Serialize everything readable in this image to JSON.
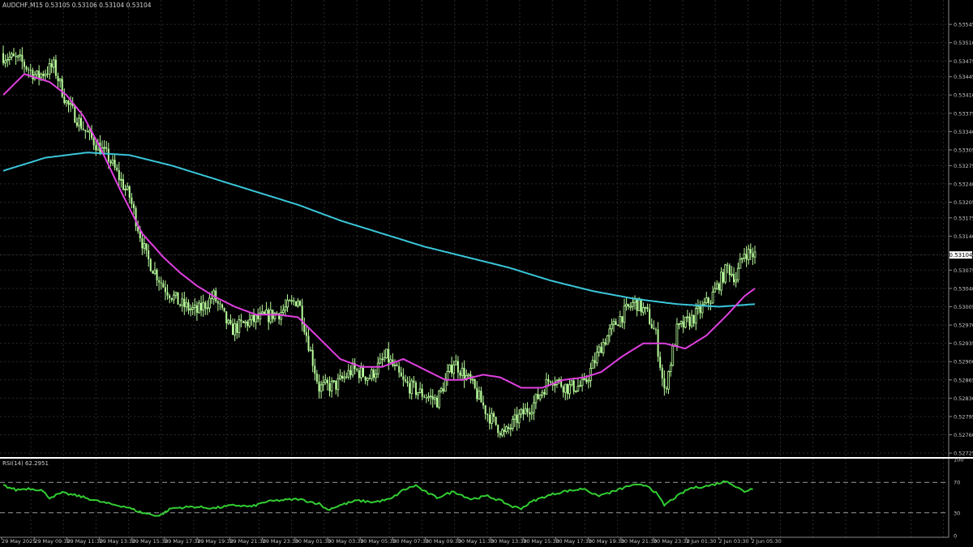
{
  "header": {
    "symbol_line": "AUDCHF,M15  0.53105 0.53106 0.53104 0.53104"
  },
  "colors": {
    "background": "#000000",
    "grid": "#2a2a2a",
    "candle": "#b9ff9c",
    "ma_fast": "#e040e0",
    "ma_slow": "#3ac6da",
    "rsi_line": "#32cd32",
    "axis_text": "#c8c8c8",
    "price_label_bg": "#ffffff",
    "price_label_text": "#000000"
  },
  "chart_data": [
    {
      "type": "candlestick",
      "title": "AUDCHF,M15",
      "ohlc_header": "0.53105 0.53106 0.53104 0.53104",
      "current_price": "0.53104",
      "grid": true,
      "ylim": [
        0.52719,
        0.5357
      ],
      "y_tick_labels": [
        "0.53545",
        "0.53510",
        "0.53475",
        "0.53445",
        "0.53410",
        "0.53375",
        "0.53340",
        "0.53305",
        "0.53275",
        "0.53240",
        "0.53205",
        "0.53175",
        "0.53140",
        "0.53104",
        "0.53075",
        "0.53040",
        "0.53005",
        "0.52970",
        "0.52935",
        "0.52900",
        "0.52865",
        "0.52830",
        "0.52795",
        "0.52760",
        "0.52725"
      ],
      "y_tick_values": [
        0.53545,
        0.5351,
        0.53475,
        0.53445,
        0.5341,
        0.53375,
        0.5334,
        0.53305,
        0.53275,
        0.5324,
        0.53205,
        0.53175,
        0.5314,
        0.53104,
        0.53075,
        0.5304,
        0.53005,
        0.5297,
        0.52935,
        0.529,
        0.52865,
        0.5283,
        0.52795,
        0.5276,
        0.52725
      ],
      "close_anchors": [
        [
          0,
          0.53485
        ],
        [
          8,
          0.53475
        ],
        [
          16,
          0.53445
        ],
        [
          24,
          0.53465
        ],
        [
          30,
          0.53395
        ],
        [
          40,
          0.53335
        ],
        [
          50,
          0.5329
        ],
        [
          60,
          0.53215
        ],
        [
          68,
          0.531
        ],
        [
          76,
          0.53045
        ],
        [
          84,
          0.5301
        ],
        [
          92,
          0.52995
        ],
        [
          100,
          0.53025
        ],
        [
          108,
          0.5296
        ],
        [
          116,
          0.52975
        ],
        [
          124,
          0.52985
        ],
        [
          132,
          0.52995
        ],
        [
          140,
          0.5302
        ],
        [
          150,
          0.5285
        ],
        [
          158,
          0.52855
        ],
        [
          166,
          0.52885
        ],
        [
          174,
          0.5287
        ],
        [
          182,
          0.5291
        ],
        [
          190,
          0.5286
        ],
        [
          198,
          0.5284
        ],
        [
          206,
          0.52825
        ],
        [
          214,
          0.529
        ],
        [
          222,
          0.5286
        ],
        [
          230,
          0.528
        ],
        [
          238,
          0.5276
        ],
        [
          244,
          0.5279
        ],
        [
          252,
          0.5282
        ],
        [
          260,
          0.5287
        ],
        [
          268,
          0.5285
        ],
        [
          276,
          0.52855
        ],
        [
          284,
          0.5293
        ],
        [
          292,
          0.5298
        ],
        [
          300,
          0.53015
        ],
        [
          306,
          0.5299
        ],
        [
          310,
          0.5295
        ],
        [
          314,
          0.5284
        ],
        [
          320,
          0.5296
        ],
        [
          328,
          0.52985
        ],
        [
          336,
          0.5302
        ],
        [
          344,
          0.5308
        ],
        [
          348,
          0.5306
        ],
        [
          352,
          0.5311
        ],
        [
          356,
          0.53105
        ],
        [
          357,
          0.53104
        ]
      ],
      "series": [
        {
          "type": "line",
          "anchors": [
            [
              0,
              0.5341
            ],
            [
              10,
              0.5345
            ],
            [
              22,
              0.53435
            ],
            [
              30,
              0.5341
            ],
            [
              38,
              0.5337
            ],
            [
              46,
              0.5331
            ],
            [
              56,
              0.53225
            ],
            [
              66,
              0.53145
            ],
            [
              76,
              0.531
            ],
            [
              84,
              0.5307
            ],
            [
              92,
              0.53045
            ],
            [
              100,
              0.53025
            ],
            [
              110,
              0.53005
            ],
            [
              120,
              0.5299
            ],
            [
              130,
              0.5299
            ],
            [
              140,
              0.52985
            ],
            [
              150,
              0.52945
            ],
            [
              160,
              0.52905
            ],
            [
              170,
              0.5289
            ],
            [
              180,
              0.5289
            ],
            [
              190,
              0.52905
            ],
            [
              200,
              0.52885
            ],
            [
              210,
              0.52865
            ],
            [
              218,
              0.52865
            ],
            [
              228,
              0.52875
            ],
            [
              236,
              0.5287
            ],
            [
              246,
              0.5285
            ],
            [
              256,
              0.5285
            ],
            [
              266,
              0.52865
            ],
            [
              276,
              0.5287
            ],
            [
              284,
              0.5288
            ],
            [
              294,
              0.5291
            ],
            [
              304,
              0.52935
            ],
            [
              314,
              0.52935
            ],
            [
              324,
              0.52925
            ],
            [
              334,
              0.5295
            ],
            [
              344,
              0.5299
            ],
            [
              352,
              0.53025
            ],
            [
              357,
              0.5304
            ]
          ]
        },
        {
          "type": "line",
          "anchors": [
            [
              0,
              0.53265
            ],
            [
              20,
              0.5329
            ],
            [
              40,
              0.533
            ],
            [
              60,
              0.53295
            ],
            [
              80,
              0.53275
            ],
            [
              100,
              0.5325
            ],
            [
              120,
              0.53225
            ],
            [
              140,
              0.532
            ],
            [
              160,
              0.5317
            ],
            [
              180,
              0.53145
            ],
            [
              200,
              0.5312
            ],
            [
              220,
              0.531
            ],
            [
              240,
              0.5308
            ],
            [
              260,
              0.53055
            ],
            [
              280,
              0.53035
            ],
            [
              300,
              0.5302
            ],
            [
              320,
              0.5301
            ],
            [
              340,
              0.53005
            ],
            [
              357,
              0.5301
            ]
          ]
        }
      ],
      "x_tick_labels": [
        "29 May 2025",
        "29 May 09:30",
        "29 May 11:30",
        "29 May 13:30",
        "29 May 15:30",
        "29 May 17:30",
        "29 May 19:30",
        "29 May 21:30",
        "29 May 23:30",
        "30 May 01:30",
        "30 May 03:30",
        "30 May 05:30",
        "30 May 07:30",
        "30 May 09:30",
        "30 May 11:30",
        "30 May 13:30",
        "30 May 15:30",
        "30 May 17:30",
        "30 May 19:30",
        "30 May 21:30",
        "30 May 23:30",
        "2 Jun 01:30",
        "2 Jun 03:30",
        "2 Jun 05:30"
      ]
    },
    {
      "type": "line",
      "title": "RSI(14) 62.2951",
      "ylim": [
        0,
        100
      ],
      "y_tick_labels": [
        "100",
        "70",
        "30",
        "0"
      ],
      "y_tick_values": [
        100,
        70,
        30,
        0
      ],
      "levels": [
        70,
        30
      ],
      "series": [
        {
          "anchors": [
            [
              0,
              66
            ],
            [
              6,
              60
            ],
            [
              12,
              62
            ],
            [
              18,
              60
            ],
            [
              22,
              50
            ],
            [
              28,
              56
            ],
            [
              36,
              52
            ],
            [
              44,
              46
            ],
            [
              50,
              42
            ],
            [
              58,
              38
            ],
            [
              66,
              30
            ],
            [
              74,
              26
            ],
            [
              80,
              36
            ],
            [
              90,
              38
            ],
            [
              100,
              36
            ],
            [
              110,
              40
            ],
            [
              118,
              38
            ],
            [
              124,
              44
            ],
            [
              130,
              46
            ],
            [
              140,
              48
            ],
            [
              150,
              42
            ],
            [
              154,
              34
            ],
            [
              160,
              40
            ],
            [
              168,
              46
            ],
            [
              176,
              44
            ],
            [
              184,
              48
            ],
            [
              190,
              60
            ],
            [
              196,
              66
            ],
            [
              200,
              58
            ],
            [
              206,
              50
            ],
            [
              214,
              58
            ],
            [
              222,
              48
            ],
            [
              230,
              52
            ],
            [
              236,
              46
            ],
            [
              242,
              38
            ],
            [
              246,
              36
            ],
            [
              252,
              46
            ],
            [
              258,
              52
            ],
            [
              266,
              58
            ],
            [
              272,
              60
            ],
            [
              276,
              62
            ],
            [
              282,
              52
            ],
            [
              290,
              58
            ],
            [
              298,
              66
            ],
            [
              306,
              66
            ],
            [
              310,
              56
            ],
            [
              314,
              40
            ],
            [
              318,
              48
            ],
            [
              326,
              62
            ],
            [
              336,
              66
            ],
            [
              344,
              72
            ],
            [
              348,
              64
            ],
            [
              352,
              58
            ],
            [
              356,
              62
            ]
          ]
        }
      ]
    }
  ]
}
